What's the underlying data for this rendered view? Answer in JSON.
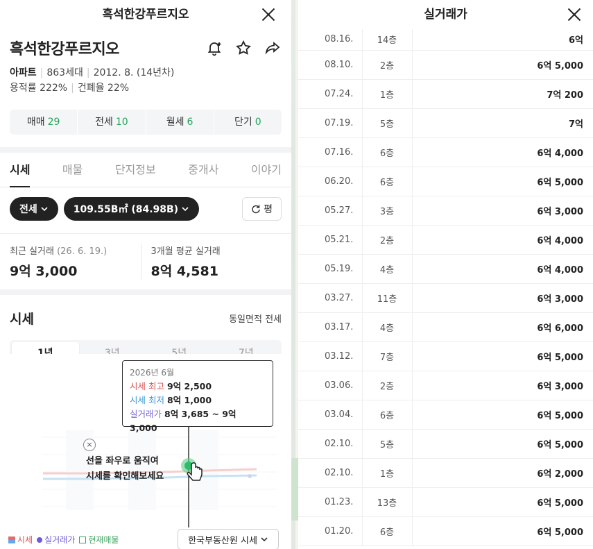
{
  "left": {
    "header_title": "흑석한강푸르지오",
    "complex_name": "흑석한강푸르지오",
    "meta": {
      "type": "아파트",
      "households": "863세대",
      "built": "2012. 8. (14년차)",
      "far": "용적률 222%",
      "bcr": "건폐율 22%"
    },
    "deal_tabs": [
      {
        "label": "매매",
        "count": "29"
      },
      {
        "label": "전세",
        "count": "10"
      },
      {
        "label": "월세",
        "count": "6"
      },
      {
        "label": "단기",
        "count": "0"
      }
    ],
    "main_tabs": [
      "시세",
      "매물",
      "단지정보",
      "중개사",
      "이야기"
    ],
    "chip_type": "전세",
    "chip_area": "109.55B㎡ (84.98B)",
    "refresh_label": "평",
    "recent": {
      "label1": "최근 실거래",
      "date1": "(26. 6. 19.)",
      "value1": "9억 3,000",
      "label2": "3개월 평균 실거래",
      "value2": "8억 4,581"
    },
    "sise_title": "시세",
    "sise_sub": "동일면적 전세",
    "periods": [
      "1년",
      "3년",
      "5년",
      "7년"
    ],
    "tooltip": {
      "date": "2026년 6월",
      "high_label": "시세 최고",
      "high_value": "9억 2,500",
      "low_label": "시세 최저",
      "low_value": "8억 1,000",
      "real_label": "실거래가",
      "real_value": "8억 3,685 ~ 9억 3,000"
    },
    "hint_close": "×",
    "hint_line1": "선을 좌우로 움직여",
    "hint_line2": "시세를 확인해보세요",
    "legend": [
      "시세",
      "실거래가",
      "현재매물"
    ],
    "source": "한국부동산원 시세"
  },
  "right": {
    "title": "실거래가",
    "rows": [
      {
        "date": "08.16.",
        "floor": "14층",
        "price": "6억"
      },
      {
        "date": "08.10.",
        "floor": "2층",
        "price": "6억 5,000"
      },
      {
        "date": "07.24.",
        "floor": "1층",
        "price": "7억 200"
      },
      {
        "date": "07.19.",
        "floor": "5층",
        "price": "7억"
      },
      {
        "date": "07.16.",
        "floor": "6층",
        "price": "6억 4,000"
      },
      {
        "date": "06.20.",
        "floor": "6층",
        "price": "6억 5,000"
      },
      {
        "date": "05.27.",
        "floor": "3층",
        "price": "6억 3,000"
      },
      {
        "date": "05.21.",
        "floor": "2층",
        "price": "6억 4,000"
      },
      {
        "date": "05.19.",
        "floor": "4층",
        "price": "6억 4,000"
      },
      {
        "date": "03.27.",
        "floor": "11층",
        "price": "6억 3,000"
      },
      {
        "date": "03.17.",
        "floor": "4층",
        "price": "6억 6,000"
      },
      {
        "date": "03.12.",
        "floor": "7층",
        "price": "6억 5,000"
      },
      {
        "date": "03.06.",
        "floor": "2층",
        "price": "6억 3,000"
      },
      {
        "date": "03.04.",
        "floor": "6층",
        "price": "6억 5,000"
      },
      {
        "date": "02.10.",
        "floor": "5층",
        "price": "6억 5,000"
      },
      {
        "date": "02.10.",
        "floor": "1층",
        "price": "6억 2,000"
      },
      {
        "date": "01.23.",
        "floor": "13층",
        "price": "6억 5,000"
      },
      {
        "date": "01.20.",
        "floor": "6층",
        "price": "6억 5,000"
      }
    ]
  },
  "colors": {
    "accent_green": "#23a659",
    "sise_red": "#e05252",
    "sise_blue": "#3a9ad9",
    "real_purple": "#7b6ad6"
  },
  "icons": [
    "close-icon",
    "bell-plus-icon",
    "star-icon",
    "share-icon",
    "chevron-down-icon",
    "refresh-icon",
    "hand-pointer-icon"
  ]
}
